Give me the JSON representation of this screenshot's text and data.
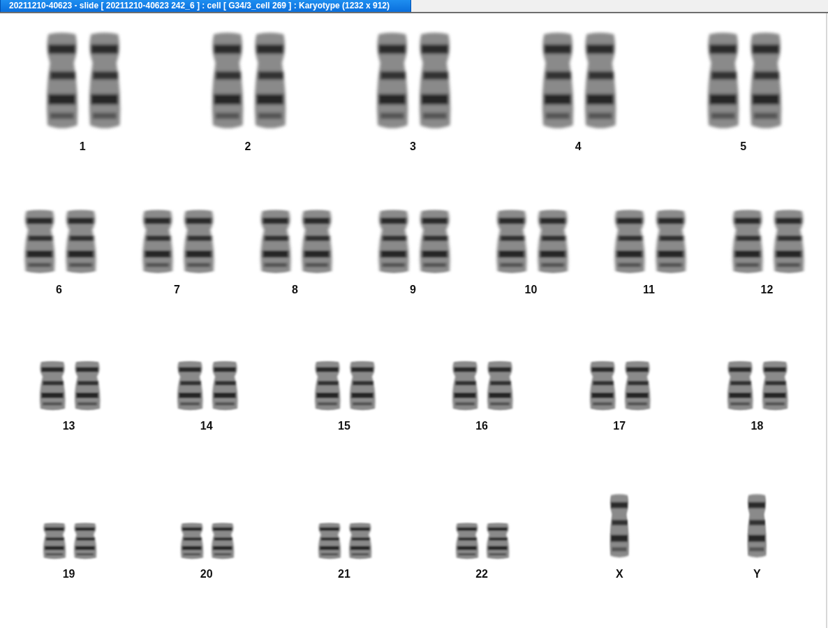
{
  "window": {
    "title": "20211210-40623 - slide [ 20211210-40623 242_6 ] : cell [ G34/3_cell 269 ] : Karyotype  (1232 x 912)"
  },
  "karyotype": {
    "rows": [
      {
        "chromosomes": [
          {
            "label": "1",
            "kind": "pair"
          },
          {
            "label": "2",
            "kind": "pair"
          },
          {
            "label": "3",
            "kind": "pair"
          },
          {
            "label": "4",
            "kind": "pair"
          },
          {
            "label": "5",
            "kind": "pair"
          }
        ]
      },
      {
        "chromosomes": [
          {
            "label": "6",
            "kind": "pair"
          },
          {
            "label": "7",
            "kind": "pair"
          },
          {
            "label": "8",
            "kind": "pair"
          },
          {
            "label": "9",
            "kind": "pair"
          },
          {
            "label": "10",
            "kind": "pair"
          },
          {
            "label": "11",
            "kind": "pair"
          },
          {
            "label": "12",
            "kind": "pair"
          }
        ]
      },
      {
        "chromosomes": [
          {
            "label": "13",
            "kind": "pair"
          },
          {
            "label": "14",
            "kind": "pair"
          },
          {
            "label": "15",
            "kind": "pair"
          },
          {
            "label": "16",
            "kind": "pair"
          },
          {
            "label": "17",
            "kind": "pair"
          },
          {
            "label": "18",
            "kind": "pair"
          }
        ]
      },
      {
        "chromosomes": [
          {
            "label": "19",
            "kind": "pair"
          },
          {
            "label": "20",
            "kind": "pair"
          },
          {
            "label": "21",
            "kind": "pair"
          },
          {
            "label": "22",
            "kind": "pair"
          },
          {
            "label": "X",
            "kind": "single"
          },
          {
            "label": "Y",
            "kind": "single"
          }
        ]
      }
    ]
  }
}
